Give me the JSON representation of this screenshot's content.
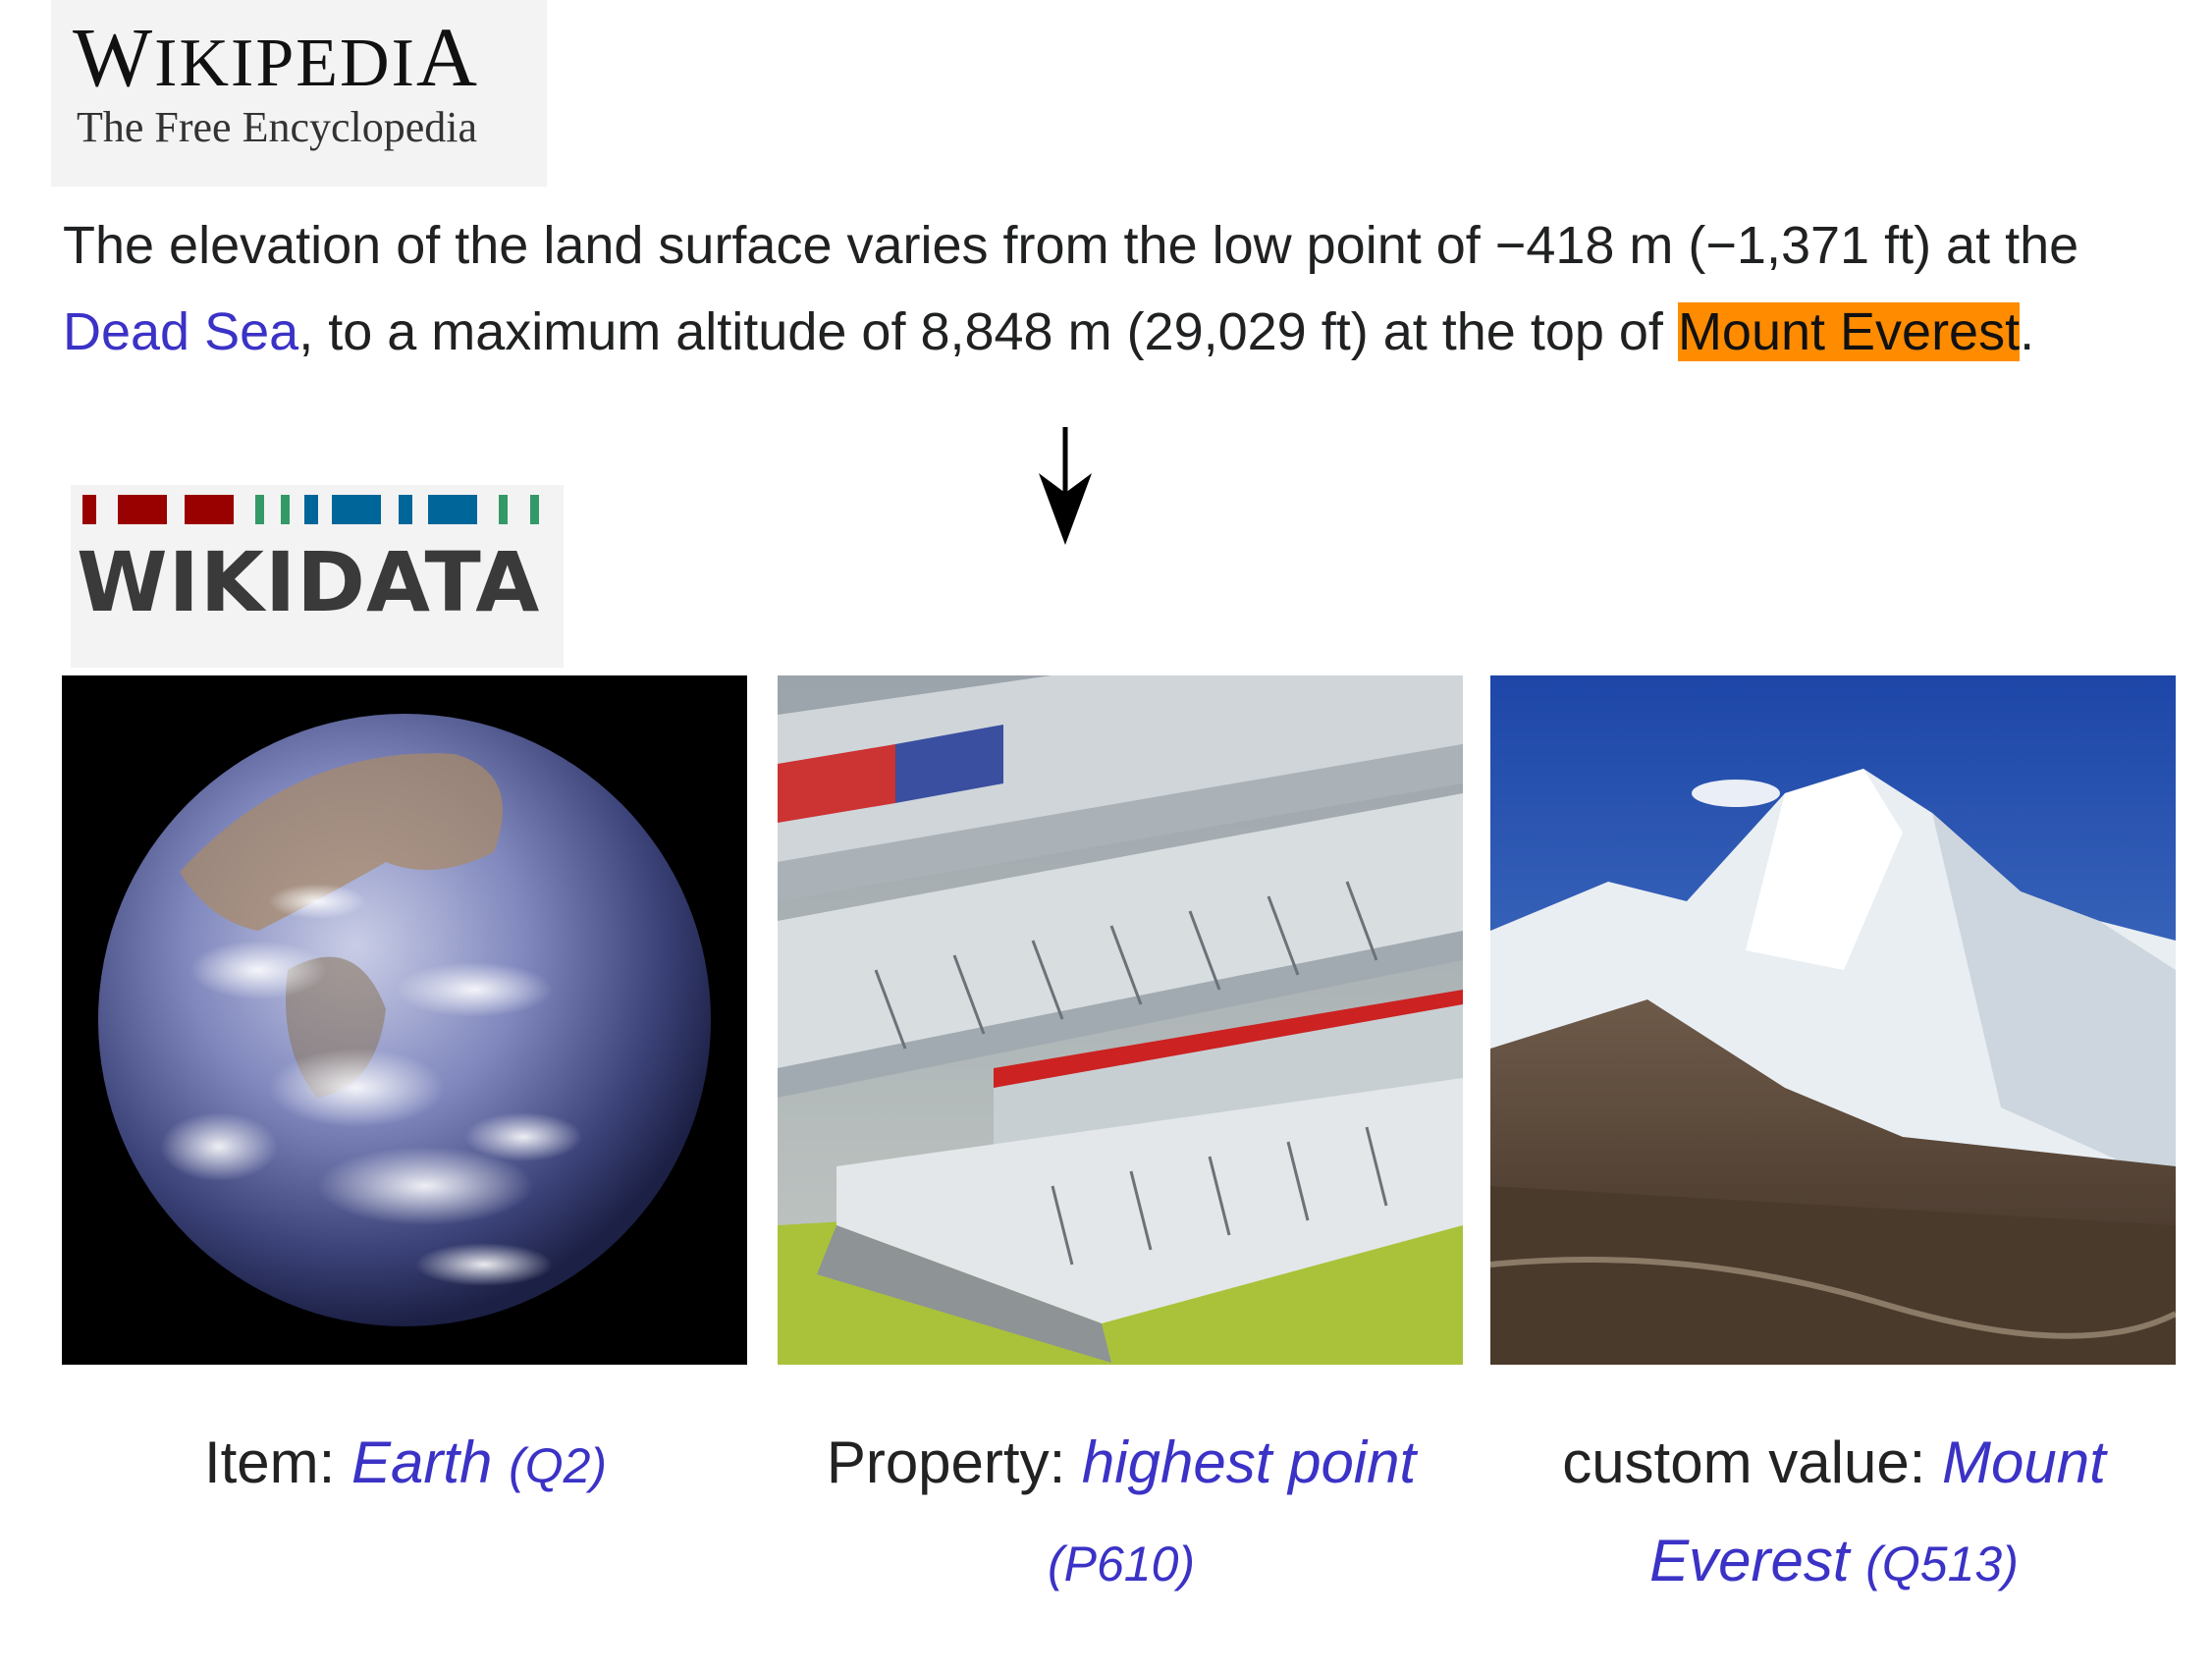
{
  "wikipedia_logo": {
    "title": "Wikipedia",
    "subtitle": "The Free Encyclopedia"
  },
  "paragraph": {
    "text_1": "The elevation of the land surface varies from the low point of −418 m (−1,371 ft) at the ",
    "link_dead_sea": "Dead Sea",
    "text_2": ", to a maximum altitude of 8,848 m (29,029 ft) at the top of ",
    "highlight": "Mount Everest",
    "text_3": "."
  },
  "colors": {
    "link": "#3b32c6",
    "highlight": "#ff8c00",
    "wd_red": "#990000",
    "wd_green": "#339966",
    "wd_blue": "#006699"
  },
  "wikidata_logo": {
    "word": "WIKIDATA"
  },
  "images": [
    {
      "name": "earth-photo",
      "subject": "Earth"
    },
    {
      "name": "folding-ruler-photo",
      "subject": "folding ruler"
    },
    {
      "name": "mount-everest-photo",
      "subject": "Mount Everest"
    }
  ],
  "captions": {
    "item": {
      "label": "Item: ",
      "value": "Earth",
      "id": "(Q2)"
    },
    "property": {
      "label": "Property: ",
      "value": "highest point",
      "id": "(P610)"
    },
    "custom": {
      "label": "custom value: ",
      "value": "Mount Everest",
      "id": "(Q513)"
    }
  }
}
